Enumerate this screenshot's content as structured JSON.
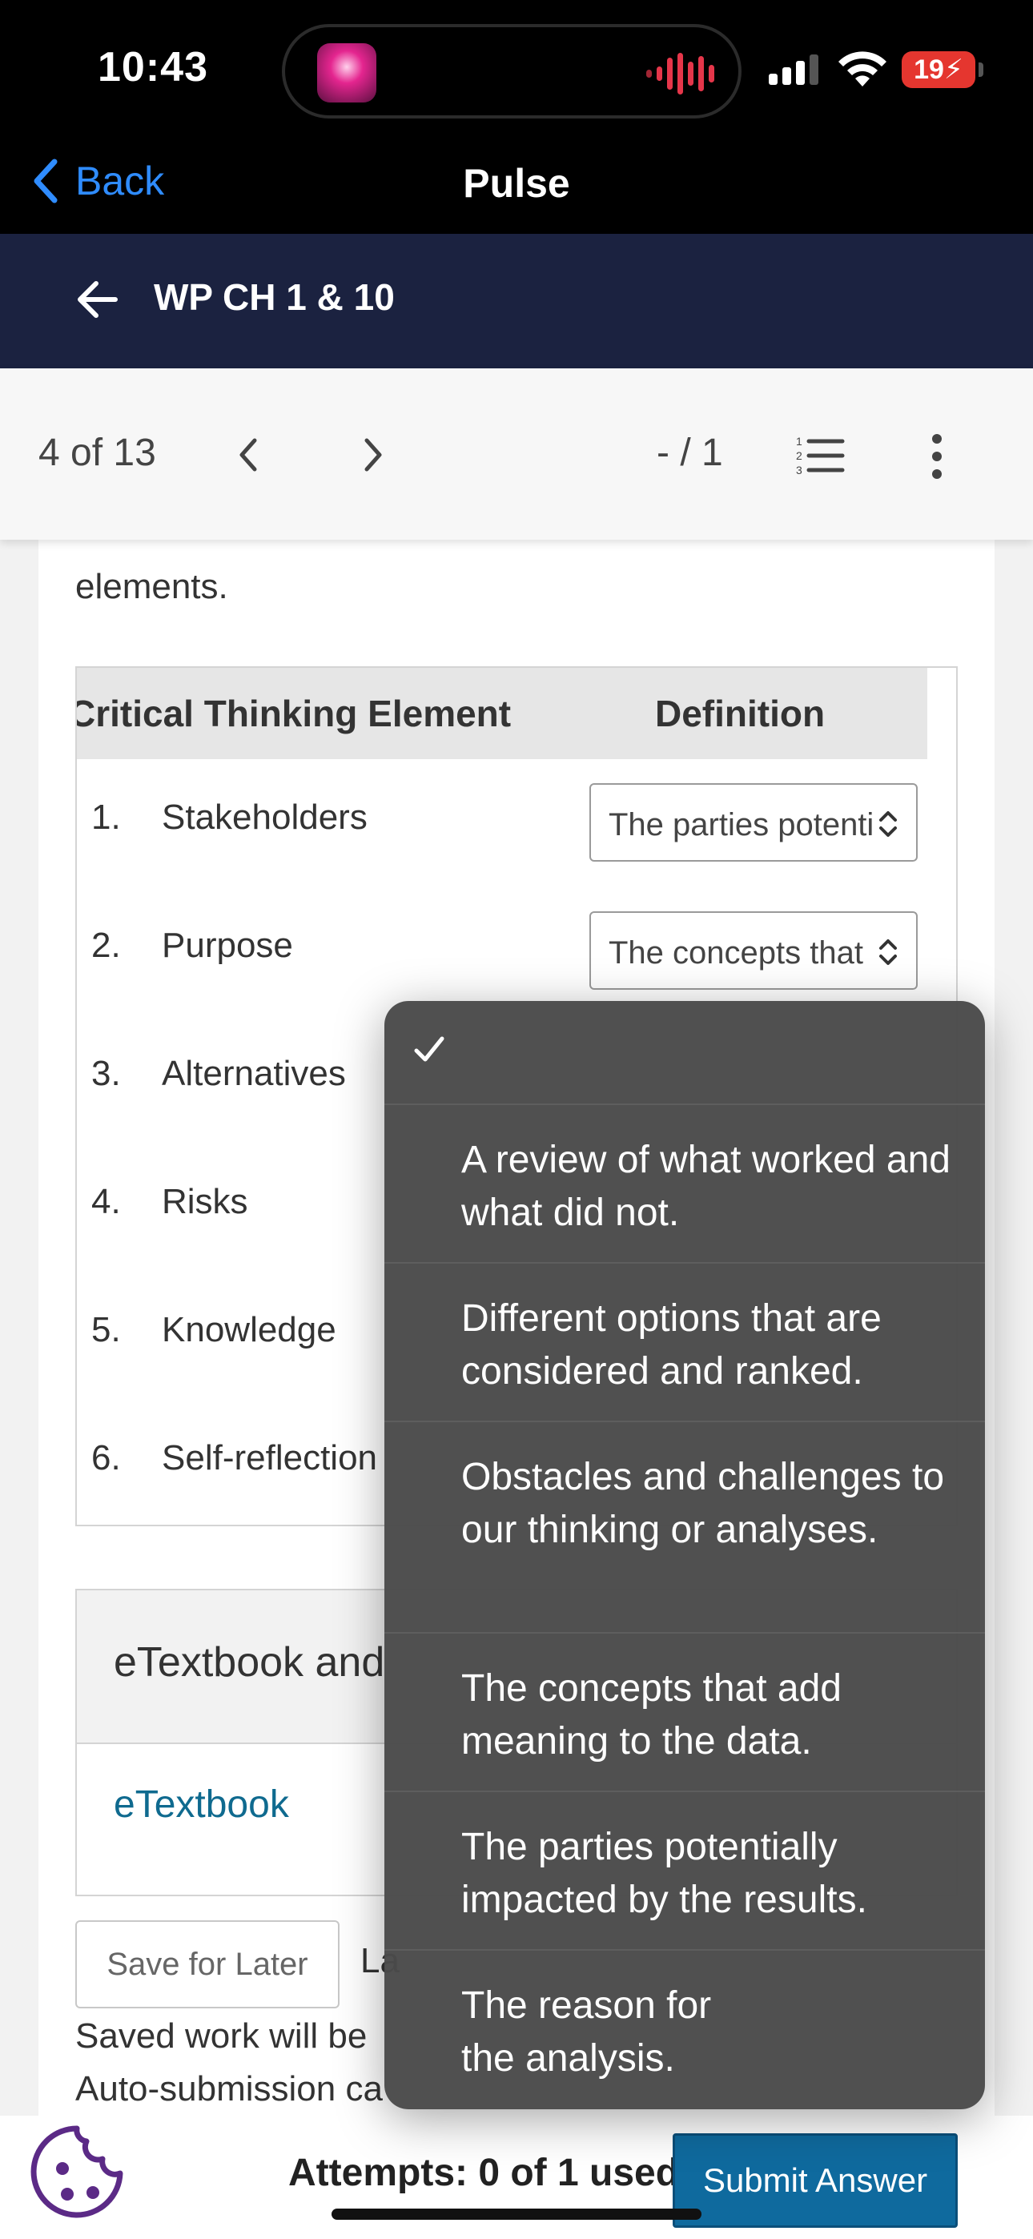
{
  "status_bar": {
    "time": "10:43",
    "battery": "19"
  },
  "nav": {
    "back_label": "Back",
    "title": "Pulse"
  },
  "course": {
    "title": "WP CH 1 & 10"
  },
  "toolbar": {
    "question_position": "4 of 13",
    "score": "- / 1"
  },
  "question": {
    "prompt_visible": "elements."
  },
  "table": {
    "header_element": "Critical Thinking Element",
    "header_definition": "Definition",
    "rows": [
      {
        "num": "1.",
        "label": "Stakeholders",
        "selected": "The parties potentially impacted by the results."
      },
      {
        "num": "2.",
        "label": "Purpose",
        "selected": "The concepts that add meaning to the data."
      },
      {
        "num": "3.",
        "label": "Alternatives"
      },
      {
        "num": "4.",
        "label": "Risks"
      },
      {
        "num": "5.",
        "label": "Knowledge"
      },
      {
        "num": "6.",
        "label": "Self-reflection"
      }
    ]
  },
  "resources": {
    "title": "eTextbook and",
    "link": "eTextbook"
  },
  "footer": {
    "save_later": "Save for Later",
    "last_saved_fragment": "La",
    "saved_note_line1": "Saved work will be",
    "saved_note_line2": "Auto-submission ca",
    "attempts": "Attempts: 0 of 1 used",
    "submit": "Submit Answer"
  },
  "picker": {
    "options": [
      "A review of what worked and what did not.",
      "Different options that are considered and ranked.",
      "Obstacles and challenges to our thinking or analyses.",
      "The concepts that add meaning to the data.",
      "The parties potentially impacted by the results.",
      "The reason for the analysis."
    ]
  }
}
